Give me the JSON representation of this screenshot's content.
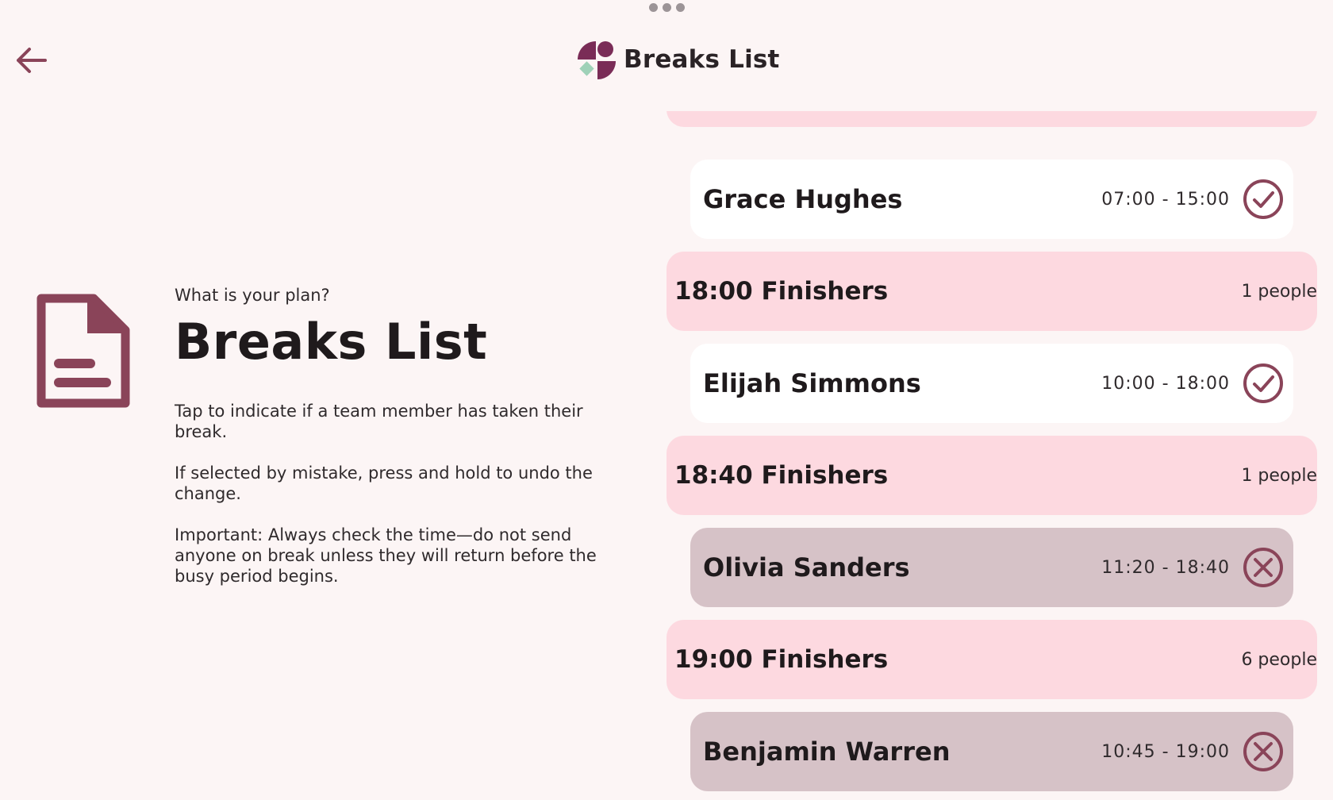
{
  "header": {
    "title": "Breaks List",
    "back_icon": "arrow-left-icon",
    "logo_icon": "app-logo-icon",
    "accent_color": "#8a4459"
  },
  "intro": {
    "icon": "document-icon",
    "eyebrow": "What is your plan?",
    "heading": "Breaks List",
    "paragraphs": [
      "Tap to indicate if a team member has taken their break.",
      "If selected by mistake, press and hold to undo the change.",
      "Important: Always check the time—do not send anyone on break unless they will return before the busy period begins."
    ]
  },
  "list": {
    "groups": [
      {
        "title": "18:00 Finishers",
        "count": "1 people"
      },
      {
        "title": "18:40 Finishers",
        "count": "1 people"
      },
      {
        "title": "19:00 Finishers",
        "count": "6 people"
      }
    ],
    "people": [
      {
        "name": "Grace Hughes",
        "time": "07:00 - 15:00",
        "status": "taken",
        "status_icon": "check-circle-icon"
      },
      {
        "name": "Elijah Simmons",
        "time": "10:00 - 18:00",
        "status": "taken",
        "status_icon": "check-circle-icon"
      },
      {
        "name": "Olivia Sanders",
        "time": "11:20 - 18:40",
        "status": "not-taken",
        "status_icon": "x-circle-icon"
      },
      {
        "name": "Benjamin Warren",
        "time": "10:45 - 19:00",
        "status": "not-taken",
        "status_icon": "x-circle-icon"
      }
    ]
  },
  "colors": {
    "background": "#fcf5f5",
    "group_header": "#fdd9e0",
    "person_taken": "#ffffff",
    "person_pending": "#d6c2c7",
    "icon": "#8a4459"
  }
}
